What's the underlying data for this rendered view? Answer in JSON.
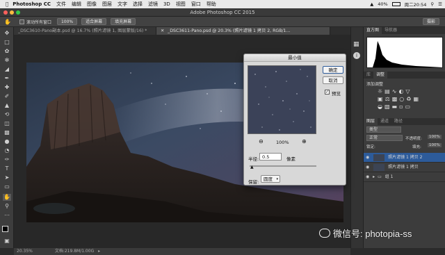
{
  "menubar": {
    "app": "Photoshop CC",
    "items": [
      "文件",
      "编辑",
      "图像",
      "图层",
      "文字",
      "选择",
      "滤镜",
      "3D",
      "视图",
      "窗口",
      "帮助"
    ],
    "battery": "40%",
    "clock": "周二20:54"
  },
  "window": {
    "title": "Adobe Photoshop CC 2015"
  },
  "options": {
    "scroll_all_label": "滚动所有窗口",
    "zoom_value": "100%",
    "fit_label": "适合屏幕",
    "fill_label": "填充屏幕",
    "workspace": "摄影"
  },
  "tabs": [
    {
      "label": "_DSC3610-Pano副本.psd @ 16.7% (照片滤镜 1, 图层蒙版/16) *"
    },
    {
      "label": "_DSC3611-Pano.psd @ 20.3% (照片滤镜 1 拷贝 2, RGB/1..."
    }
  ],
  "status": {
    "zoom": "20.35%",
    "doc": "文档:219.8M/1.00G"
  },
  "dialog": {
    "title": "最小值",
    "ok": "确定",
    "cancel": "取消",
    "preview_label": "预览",
    "preview_checked": true,
    "zoom": "100%",
    "radius_label": "半径:",
    "radius_value": "0.5",
    "radius_unit": "像素",
    "preserve_label": "保留:",
    "preserve_value": "圆度"
  },
  "panels": {
    "histogram_tabs": [
      "直方图",
      "导航器"
    ],
    "adjust_tabs": [
      "库",
      "调整"
    ],
    "adjust_title": "添加调整",
    "layers_tabs": [
      "图层",
      "通道",
      "路径"
    ],
    "kind_filter": "类型",
    "blend_mode": "正常",
    "opacity_label": "不透明度:",
    "opacity_value": "100%",
    "lock_label": "锁定:",
    "fill_label": "填充:",
    "fill_value": "100%",
    "layers": [
      {
        "name": "照片滤镜 1 拷贝 2",
        "selected": true
      },
      {
        "name": "照片滤镜 1 拷贝",
        "selected": false
      },
      {
        "name": "组 1",
        "selected": false
      }
    ]
  },
  "watermark": {
    "text": "微信号: photopia-ss"
  },
  "colors": {
    "accent": "#2d5b9a",
    "dialog_bg": "#d8d8d8",
    "ui_dark": "#3c3c3c"
  }
}
